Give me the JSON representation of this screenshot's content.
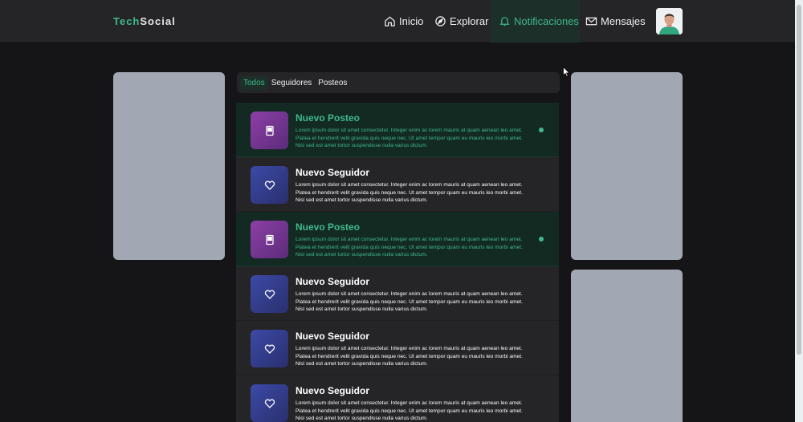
{
  "navbar": {
    "logo_part1": "Tech",
    "logo_part2": "Social",
    "items": [
      {
        "label": "Inicio",
        "icon": "home-icon"
      },
      {
        "label": "Explorar",
        "icon": "compass-icon"
      },
      {
        "label": "Notificaciones",
        "icon": "bell-icon",
        "active": true
      },
      {
        "label": "Mensajes",
        "icon": "mail-icon"
      }
    ]
  },
  "tabs": [
    {
      "label": "Todos",
      "active": true
    },
    {
      "label": "Seguidores"
    },
    {
      "label": "Posteos"
    }
  ],
  "notifications": [
    {
      "title": "Nuevo Posteo",
      "type": "post",
      "unread": true,
      "body": "Lorem ipsum dolor sit amet consectetur. Integer enim ac lorem mauris at quam aenean leo amet. Platea et hendrerit velit gravida quis neque nec. Ut amet tempor quam eu mauris leo morbi amet. Nisl sed est amet tortor suspendisse nulla varius dictum."
    },
    {
      "title": "Nuevo Seguidor",
      "type": "follow",
      "unread": false,
      "body": "Lorem ipsum dolor sit amet consectetur. Integer enim ac lorem mauris at quam aenean leo amet. Platea et hendrerit velit gravida quis neque nec. Ut amet tempor quam eu mauris leo morbi amet. Nisl sed est amet tortor suspendisse nulla varius dictum."
    },
    {
      "title": "Nuevo Posteo",
      "type": "post",
      "unread": true,
      "body": "Lorem ipsum dolor sit amet consectetur. Integer enim ac lorem mauris at quam aenean leo amet. Platea et hendrerit velit gravida quis neque nec. Ut amet tempor quam eu mauris leo morbi amet. Nisl sed est amet tortor suspendisse nulla varius dictum."
    },
    {
      "title": "Nuevo Seguidor",
      "type": "follow",
      "unread": false,
      "body": "Lorem ipsum dolor sit amet consectetur. Integer enim ac lorem mauris at quam aenean leo amet. Platea et hendrerit velit gravida quis neque nec. Ut amet tempor quam eu mauris leo morbi amet. Nisl sed est amet tortor suspendisse nulla varius dictum."
    },
    {
      "title": "Nuevo Seguidor",
      "type": "follow",
      "unread": false,
      "body": "Lorem ipsum dolor sit amet consectetur. Integer enim ac lorem mauris at quam aenean leo amet. Platea et hendrerit velit gravida quis neque nec. Ut amet tempor quam eu mauris leo morbi amet. Nisl sed est amet tortor suspendisse nulla varius dictum."
    },
    {
      "title": "Nuevo Seguidor",
      "type": "follow",
      "unread": false,
      "body": "Lorem ipsum dolor sit amet consectetur. Integer enim ac lorem mauris at quam aenean leo amet. Platea et hendrerit velit gravida quis neque nec. Ut amet tempor quam eu mauris leo morbi amet. Nisl sed est amet tortor suspendisse nulla varius dictum."
    }
  ],
  "colors": {
    "accent": "#3fb98b",
    "background": "#151517",
    "surface": "#252528",
    "unread_surface": "#132a23",
    "placeholder_card": "#a2a8b3",
    "post_icon_bg": "#8d3fa6",
    "follow_icon_bg": "#3b4aa6"
  }
}
